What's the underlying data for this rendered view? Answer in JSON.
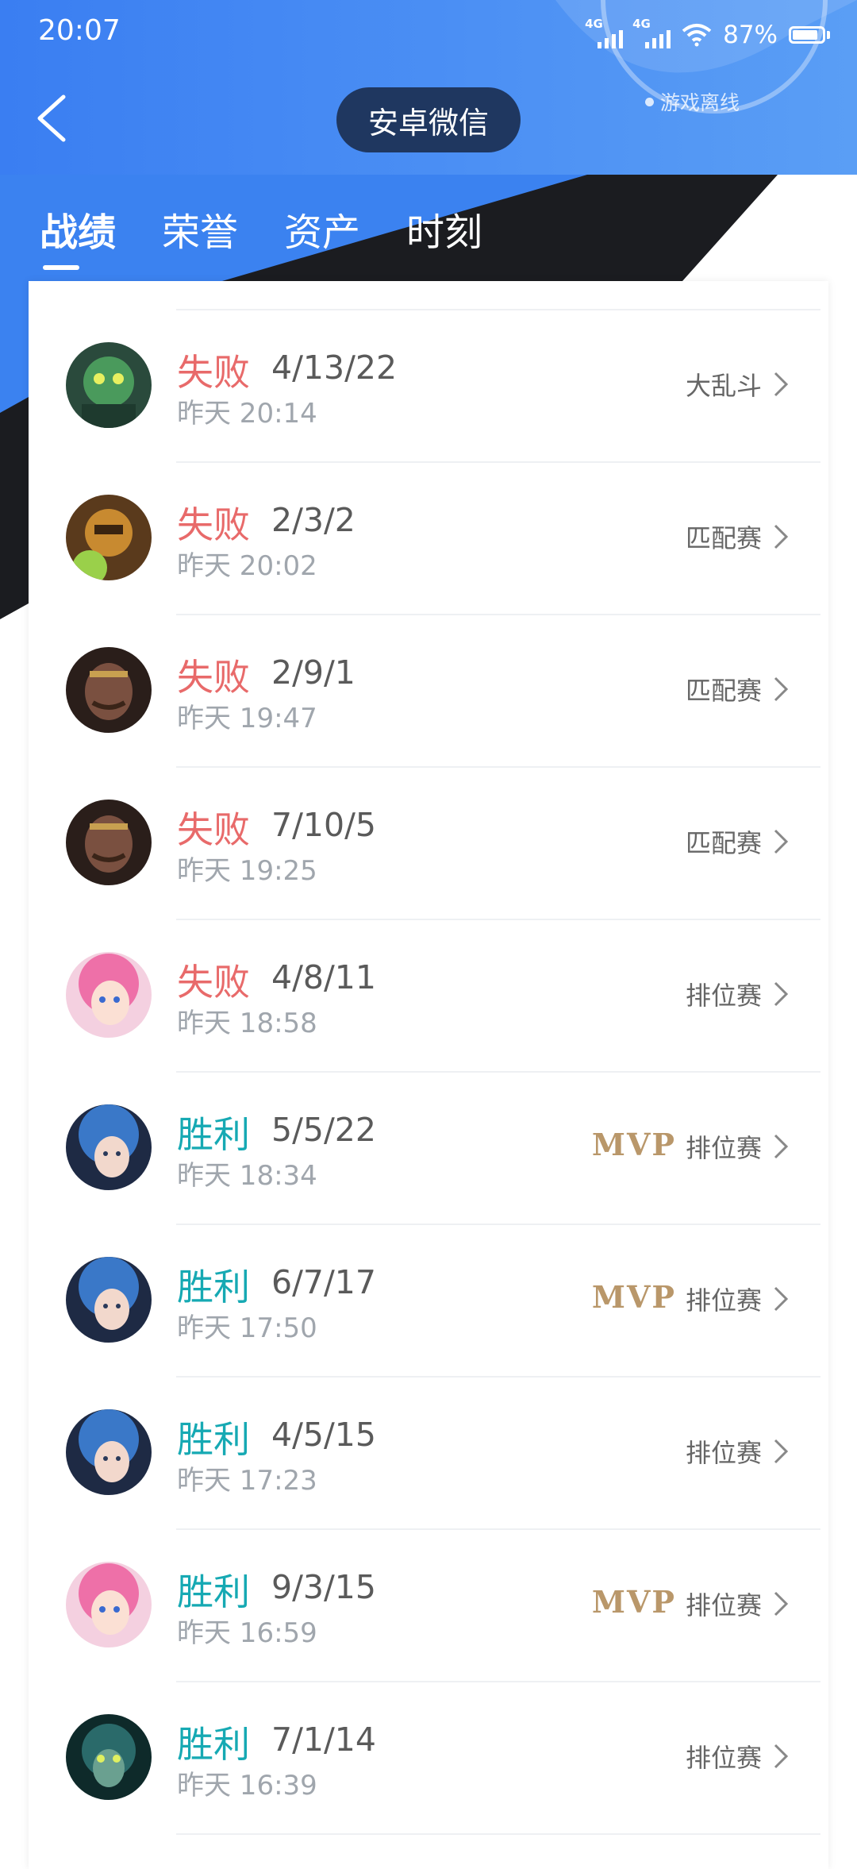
{
  "status_bar": {
    "time": "20:07",
    "signal1": "4G",
    "signal2": "4G",
    "battery": "87%"
  },
  "header": {
    "title": "安卓微信",
    "online_status": "游戏离线"
  },
  "tabs": [
    {
      "label": "战绩",
      "active": true
    },
    {
      "label": "荣誉",
      "active": false
    },
    {
      "label": "资产",
      "active": false
    },
    {
      "label": "时刻",
      "active": false
    }
  ],
  "colors": {
    "loss": "#e86a6a",
    "win": "#16a9b3",
    "mvp": "#b9976a",
    "header_blue": "#3b82f0"
  },
  "matches": [
    {
      "result": "失败",
      "kda": "4/13/22",
      "time": "昨天 20:14",
      "mode": "大乱斗",
      "mvp": "",
      "outcome": "loss",
      "avatar": "green-hero-avatar"
    },
    {
      "result": "失败",
      "kda": "2/3/2",
      "time": "昨天 20:02",
      "mode": "匹配赛",
      "mvp": "",
      "outcome": "loss",
      "avatar": "golden-armor-hero-avatar"
    },
    {
      "result": "失败",
      "kda": "2/9/1",
      "time": "昨天 19:47",
      "mode": "匹配赛",
      "mvp": "",
      "outcome": "loss",
      "avatar": "mustache-hero-avatar"
    },
    {
      "result": "失败",
      "kda": "7/10/5",
      "time": "昨天 19:25",
      "mode": "匹配赛",
      "mvp": "",
      "outcome": "loss",
      "avatar": "mustache-hero-avatar"
    },
    {
      "result": "失败",
      "kda": "4/8/11",
      "time": "昨天 18:58",
      "mode": "排位赛",
      "mvp": "",
      "outcome": "loss",
      "avatar": "pink-hair-hero-avatar"
    },
    {
      "result": "胜利",
      "kda": "5/5/22",
      "time": "昨天 18:34",
      "mode": "排位赛",
      "mvp": "MVP",
      "outcome": "win",
      "avatar": "blue-hair-hero-avatar"
    },
    {
      "result": "胜利",
      "kda": "6/7/17",
      "time": "昨天 17:50",
      "mode": "排位赛",
      "mvp": "MVP",
      "outcome": "win",
      "avatar": "blue-hair-hero-avatar"
    },
    {
      "result": "胜利",
      "kda": "4/5/15",
      "time": "昨天 17:23",
      "mode": "排位赛",
      "mvp": "",
      "outcome": "win",
      "avatar": "blue-hair-hero-avatar"
    },
    {
      "result": "胜利",
      "kda": "9/3/15",
      "time": "昨天 16:59",
      "mode": "排位赛",
      "mvp": "MVP",
      "outcome": "win",
      "avatar": "pink-hair-hero-avatar"
    },
    {
      "result": "胜利",
      "kda": "7/1/14",
      "time": "昨天 16:39",
      "mode": "排位赛",
      "mvp": "",
      "outcome": "win",
      "avatar": "masked-hero-avatar"
    }
  ]
}
